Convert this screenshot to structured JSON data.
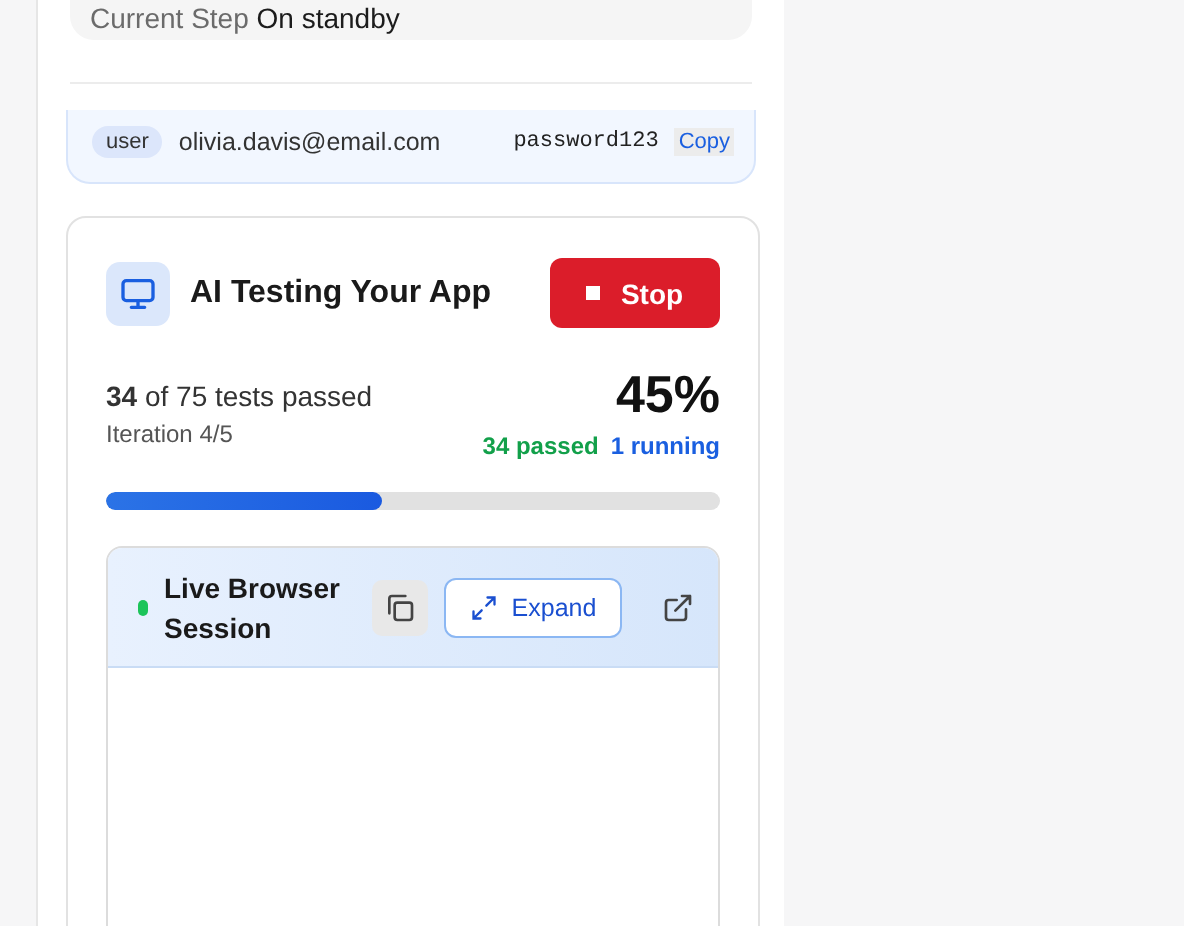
{
  "current_step": {
    "label": "Current Step",
    "value": "On standby"
  },
  "credential": {
    "role": "user",
    "email": "olivia.davis@email.com",
    "password": "password123",
    "copy_label": "Copy"
  },
  "testing": {
    "title": "AI Testing Your App",
    "stop_label": "Stop",
    "summary": "**34** of 75 tests passed",
    "iteration": "Iteration 4/5",
    "percent": "45%",
    "passed": "34 passed",
    "running": "1 running",
    "level": 0.45
  },
  "browser": {
    "title": "Live Browser Session",
    "live": true,
    "expand_label": "Expand"
  }
}
